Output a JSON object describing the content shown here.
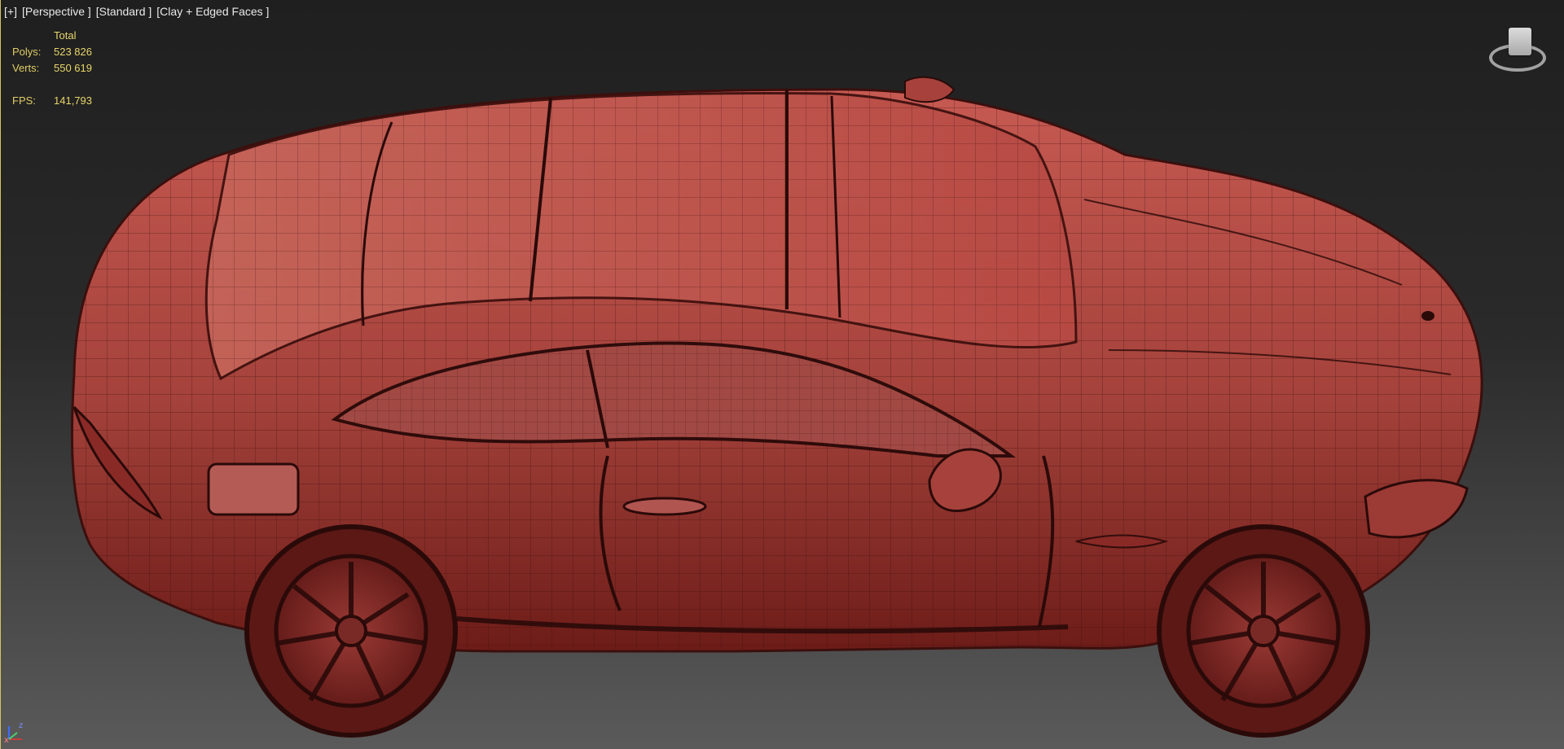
{
  "viewport": {
    "label_plus": "[+]",
    "label_view": "[Perspective ]",
    "label_shading": "[Standard ]",
    "label_mode": "[Clay + Edged Faces ]"
  },
  "stats": {
    "total_label": "Total",
    "polys_label": "Polys:",
    "polys_value": "523 826",
    "verts_label": "Verts:",
    "verts_value": "550 619",
    "fps_label": "FPS:",
    "fps_value": "141,793"
  },
  "axis": {
    "z_label": "z",
    "x_label": "x"
  },
  "colors": {
    "stats_text": "#e8d66a",
    "label_text": "#e9e9e9",
    "clay": "#b84a44",
    "wire": "#3b0f0d",
    "viewport_border": "#d6c35f"
  },
  "icons": {
    "viewcube": "viewcube-icon",
    "axis_tripod": "axis-tripod-icon"
  }
}
